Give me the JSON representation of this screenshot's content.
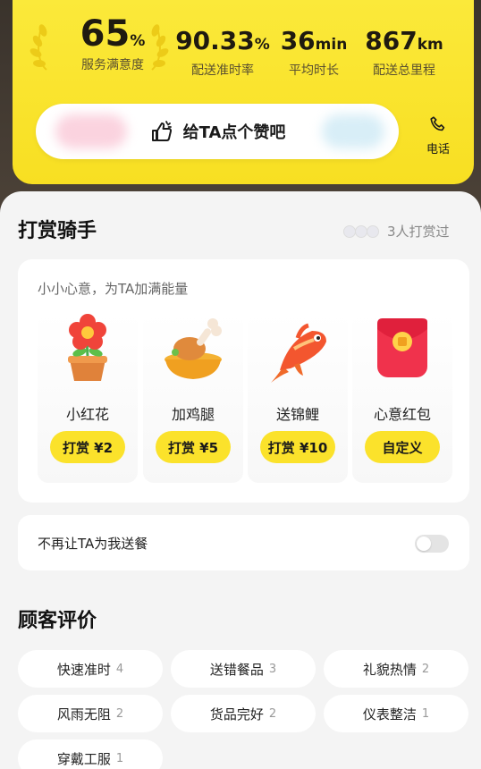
{
  "stats": [
    {
      "value": "65",
      "unit": "%",
      "label": "服务满意度"
    },
    {
      "value": "90.33",
      "unit": "%",
      "label": "配送准时率"
    },
    {
      "value": "36",
      "unit": "min",
      "label": "平均时长"
    },
    {
      "value": "867",
      "unit": "km",
      "label": "配送总里程"
    }
  ],
  "like_button": {
    "label": "给TA点个赞吧",
    "icon": "thumbs-up-icon"
  },
  "phone": {
    "label": "电话",
    "icon": "phone-icon"
  },
  "tip": {
    "title": "打赏骑手",
    "count_label": "3人打赏过",
    "subtitle": "小小心意，为TA加满能量",
    "gifts": [
      {
        "name": "小红花",
        "button": "打赏 ¥2",
        "icon": "flower-icon"
      },
      {
        "name": "加鸡腿",
        "button": "打赏 ¥5",
        "icon": "chicken-leg-icon"
      },
      {
        "name": "送锦鲤",
        "button": "打赏 ¥10",
        "icon": "koi-fish-icon"
      },
      {
        "name": "心意红包",
        "button": "自定义",
        "icon": "red-envelope-icon"
      }
    ]
  },
  "option": {
    "label": "不再让TA为我送餐",
    "enabled": false
  },
  "reviews": {
    "title": "顾客评价",
    "tags": [
      {
        "label": "快速准时",
        "count": "4"
      },
      {
        "label": "送错餐品",
        "count": "3"
      },
      {
        "label": "礼貌热情",
        "count": "2"
      },
      {
        "label": "风雨无阻",
        "count": "2"
      },
      {
        "label": "货品完好",
        "count": "2"
      },
      {
        "label": "仪表整洁",
        "count": "1"
      },
      {
        "label": "穿戴工服",
        "count": "1"
      }
    ]
  },
  "colors": {
    "accent": "#fbe22b",
    "card_bg": "#ffffff",
    "sheet_bg": "#f4f4f4"
  }
}
